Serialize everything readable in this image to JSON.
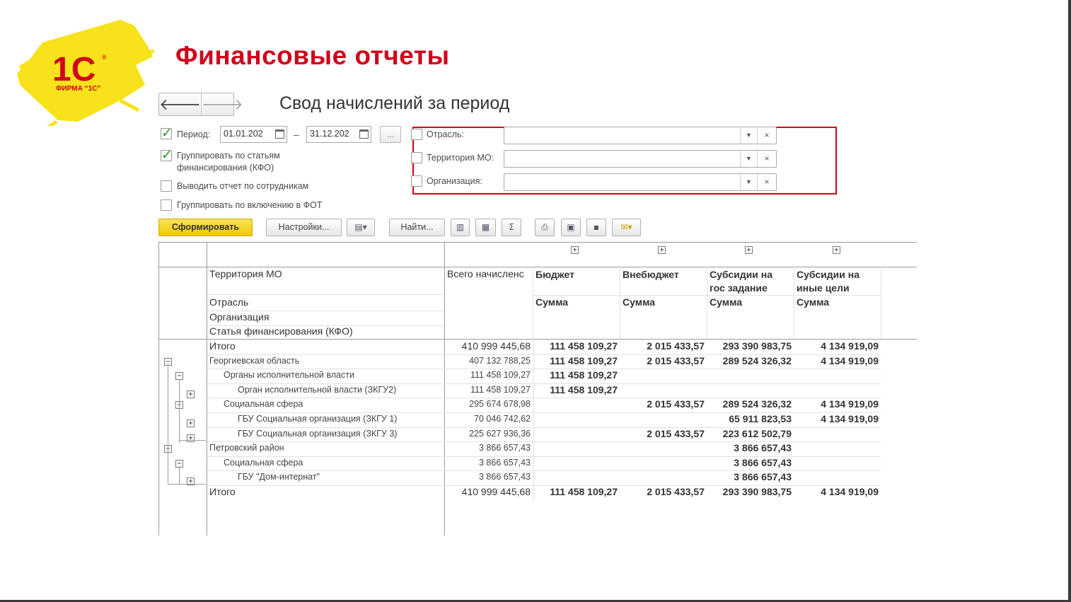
{
  "slide": {
    "title": "Финансовые отчеты",
    "logo_text": "ФИРМА “1С”",
    "logo_mark": "1С",
    "logo_brand_color": "#d0021b",
    "logo_splash_color": "#f7e21b"
  },
  "form": {
    "title": "Свод начислений за период",
    "nav": {
      "back_icon": "arrow-left-icon",
      "forward_icon": "arrow-right-icon",
      "back": "🡐",
      "forward": "🡒"
    },
    "period": {
      "label": "Период:",
      "checked": true,
      "from": "01.01.202",
      "to": "31.12.202",
      "dash": "–",
      "more": "..."
    },
    "options": [
      {
        "label": "Группировать по статьям\nфинансирования (КФО)",
        "checked": true
      },
      {
        "label": "Выводить отчет по сотрудникам",
        "checked": false
      },
      {
        "label": "Группировать по включению в ФОТ",
        "checked": false
      }
    ],
    "filters": [
      {
        "label": "Отрасль:",
        "value": "",
        "checked": false
      },
      {
        "label": "Территория МО:",
        "value": "",
        "checked": false
      },
      {
        "label": "Организация:",
        "value": "",
        "checked": false
      }
    ],
    "filter_highlight_color": "#d0021b"
  },
  "toolbar": {
    "generate": "Сформировать",
    "settings": "Настройки...",
    "find": "Найти...",
    "sum_icon": "Σ",
    "accent_color": "#f5d11a"
  },
  "report": {
    "expanders": [
      "+",
      "+",
      "+",
      "+"
    ],
    "header": {
      "row_dims": [
        "Территория МО",
        "Отрасль",
        "Организация",
        "Статья финансирования (КФО)"
      ],
      "total_col": "Всего начисленс",
      "columns": [
        {
          "name": "Бюджет",
          "sub": "Сумма"
        },
        {
          "name": "Внебюджет",
          "sub": "Сумма"
        },
        {
          "name": "Субсидии на\nгос задание",
          "sub": "Сумма"
        },
        {
          "name": "Субсидии на\nиные цели",
          "sub": "Сумма"
        }
      ]
    },
    "rows": [
      {
        "label": "Итого",
        "total": "410 999 445,68",
        "v": [
          "111 458 109,27",
          "2 015 433,57",
          "293 390 983,75",
          "4 134 919,09"
        ],
        "level": 0,
        "style": "total"
      },
      {
        "label": "Георгиевская область",
        "total": "407 132 788,25",
        "v": [
          "111 458 109,27",
          "2 015 433,57",
          "289 524 326,32",
          "4 134 919,09"
        ],
        "level": 0,
        "style": "small",
        "toggle": "−"
      },
      {
        "label": "Органы исполнительной власти",
        "total": "111 458 109,27",
        "v": [
          "111 458 109,27",
          "",
          "",
          ""
        ],
        "level": 1,
        "style": "small",
        "toggle": "−"
      },
      {
        "label": "Орган исполнительной власти (ЗКГУ2)",
        "total": "111 458 109,27",
        "v": [
          "111 458 109,27",
          "",
          "",
          ""
        ],
        "level": 2,
        "style": "small",
        "toggle": "+"
      },
      {
        "label": "Социальная сфера",
        "total": "295 674 678,98",
        "v": [
          "",
          "2 015 433,57",
          "289 524 326,32",
          "4 134 919,09"
        ],
        "level": 1,
        "style": "small",
        "toggle": "−"
      },
      {
        "label": "ГБУ Социальная организация (ЗКГУ 1)",
        "total": "70 046 742,62",
        "v": [
          "",
          "",
          "65 911 823,53",
          "4 134 919,09"
        ],
        "level": 2,
        "style": "small",
        "toggle": "+"
      },
      {
        "label": "ГБУ Социальная организация (ЗКГУ 3)",
        "total": "225 627 936,36",
        "v": [
          "",
          "2 015 433,57",
          "223 612 502,79",
          ""
        ],
        "level": 2,
        "style": "small",
        "toggle": "+"
      },
      {
        "label": "Петровский район",
        "total": "3 866 657,43",
        "v": [
          "",
          "",
          "3 866 657,43",
          ""
        ],
        "level": 0,
        "style": "small",
        "toggle": "−"
      },
      {
        "label": "Социальная сфера",
        "total": "3 866 657,43",
        "v": [
          "",
          "",
          "3 866 657,43",
          ""
        ],
        "level": 1,
        "style": "small",
        "toggle": "−"
      },
      {
        "label": "ГБУ \"Дом-интернат\"",
        "total": "3 866 657,43",
        "v": [
          "",
          "",
          "3 866 657,43",
          ""
        ],
        "level": 2,
        "style": "small",
        "toggle": "+"
      },
      {
        "label": "Итого",
        "total": "410 999 445,68",
        "v": [
          "111 458 109,27",
          "2 015 433,57",
          "293 390 983,75",
          "4 134 919,09"
        ],
        "level": 0,
        "style": "total"
      }
    ]
  }
}
